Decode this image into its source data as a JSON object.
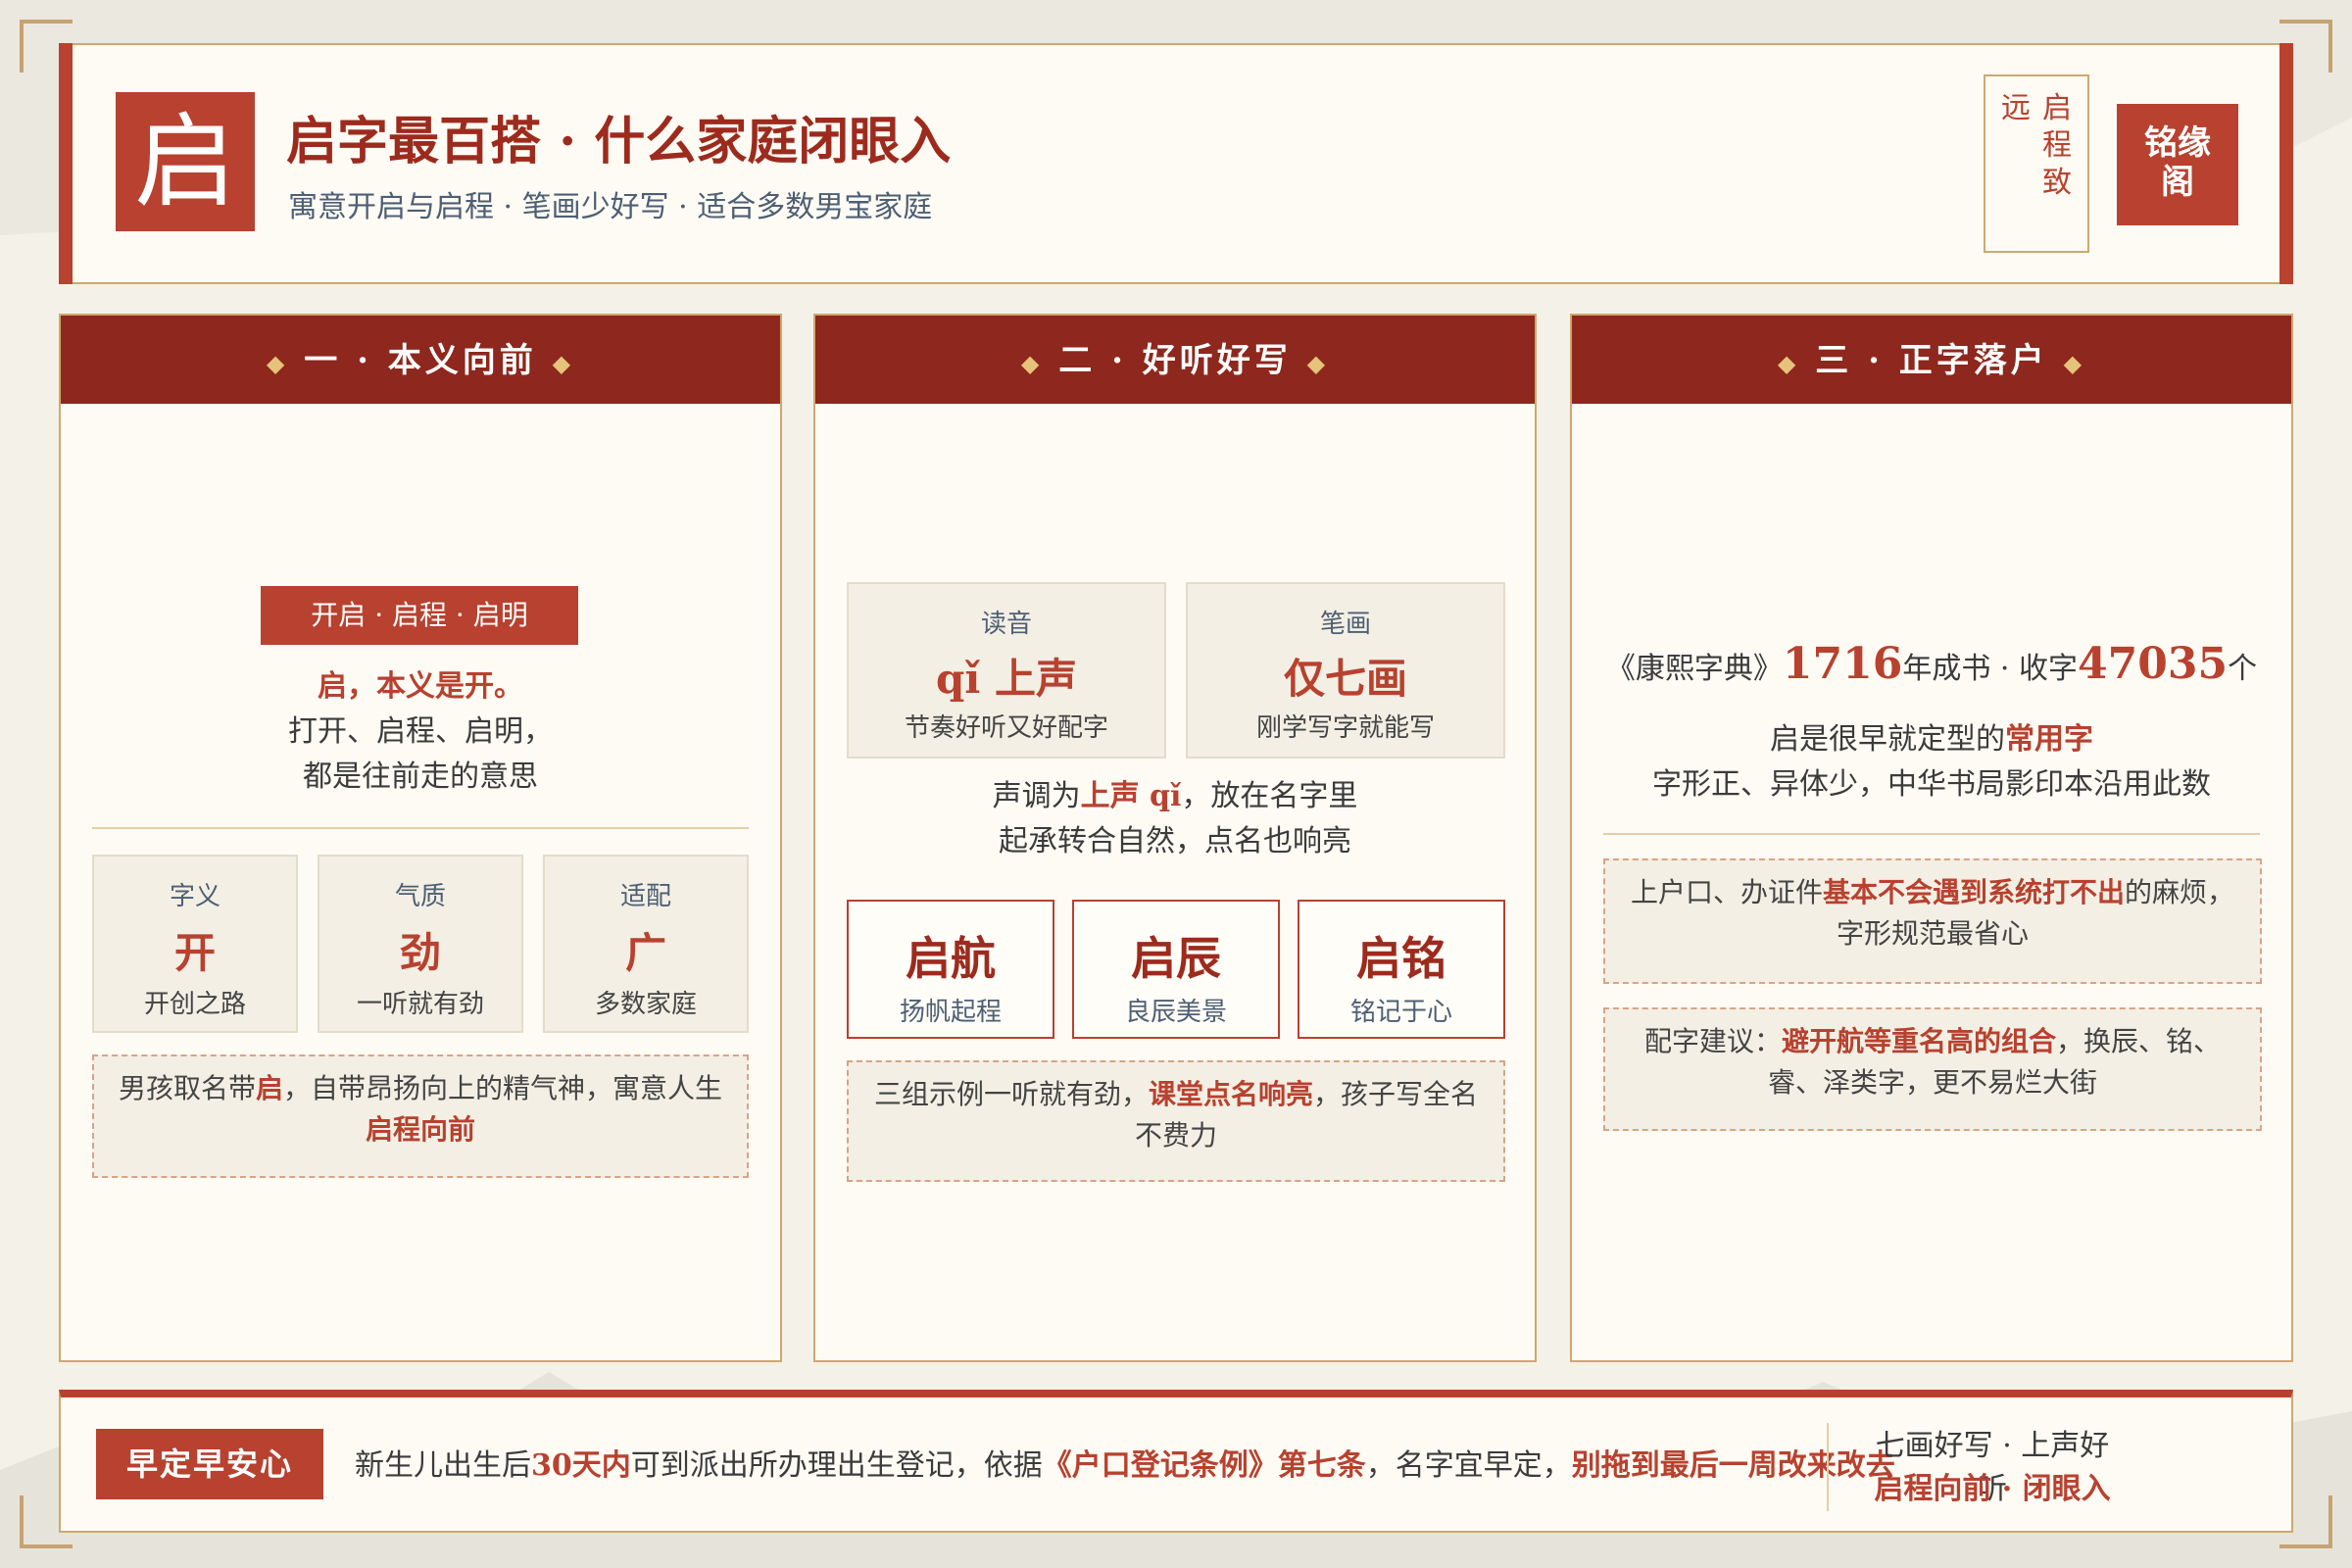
{
  "header": {
    "logo_char": "启",
    "title": "启字最百搭 · 什么家庭闭眼入",
    "subtitle": "寓意开启与启程 · 笔画少好写 · 适合多数男宝家庭",
    "seal_outline": {
      "col1": "启程致",
      "col2": "远"
    },
    "seal_red": {
      "line1": "铭缘",
      "line2": "阁"
    }
  },
  "card1": {
    "header": "一 · 本义向前",
    "pill": "开启 · 启程 · 启明",
    "lead_bold": "启，本义是开。",
    "line2": "打开、启程、启明，",
    "line3": "都是往前走的意思",
    "boxes": [
      {
        "label": "字义",
        "big": "开",
        "desc": "开创之路"
      },
      {
        "label": "气质",
        "big": "劲",
        "desc": "一听就有劲"
      },
      {
        "label": "适配",
        "big": "广",
        "desc": "多数家庭"
      }
    ],
    "note": {
      "p1": "男孩取名带",
      "r1": "启",
      "p2": "，自带昂扬向上的精气神，寓意人生",
      "r2": "启程向前"
    }
  },
  "card2": {
    "header": "二 · 好听好写",
    "boxes": [
      {
        "label": "读音",
        "big": "qǐ 上声",
        "desc": "节奏好听又好配字"
      },
      {
        "label": "笔画",
        "big": "仅七画",
        "desc": "刚学写字就能写"
      }
    ],
    "tone": {
      "p1": "声调为",
      "r1": "上声 qǐ",
      "p2": "，放在名字里",
      "line2": "起承转合自然，点名也响亮"
    },
    "names": [
      {
        "name": "启航",
        "meaning": "扬帆起程"
      },
      {
        "name": "启辰",
        "meaning": "良辰美景"
      },
      {
        "name": "启铭",
        "meaning": "铭记于心"
      }
    ],
    "note": {
      "p1": "三组示例一听就有劲，",
      "r1": "课堂点名响亮",
      "p2": "，孩子写全名不费力"
    }
  },
  "card3": {
    "header": "三 · 正字落户",
    "stat": {
      "p1": "《康熙字典》",
      "n1": "1716",
      "p2": "年成书 · 收字",
      "n2": "47035",
      "p3": "个"
    },
    "line1": {
      "p1": "启是很早就定型的",
      "r1": "常用字"
    },
    "line2": "字形正、异体少，中华书局影印本沿用此数",
    "note1": {
      "p1": "上户口、办证件",
      "r1": "基本不会遇到系统打不出",
      "p2": "的麻烦，字形规范最省心"
    },
    "note2": {
      "p1": "配字建议：",
      "r1": "避开航等重名高的组合",
      "p2": "，换辰、铭、睿、泽类字，更不易烂大街"
    }
  },
  "footer": {
    "badge": "早定早安心",
    "t1": "新生儿出生后",
    "b1": "30天内",
    "t2": "可到派出所办理出生登记，依据",
    "b2": "《户口登记条例》第七条",
    "t3": "，名字宜早定，",
    "b3": "别拖到最后一周改来改去",
    "right1": "七画好写 · 上声好听",
    "right2": "启程向前 · 闭眼入"
  },
  "colors": {
    "accent_red": "#b8412f",
    "dark_red": "#8e271d",
    "gold": "#cfa86f",
    "paper": "#fdfbf4"
  }
}
